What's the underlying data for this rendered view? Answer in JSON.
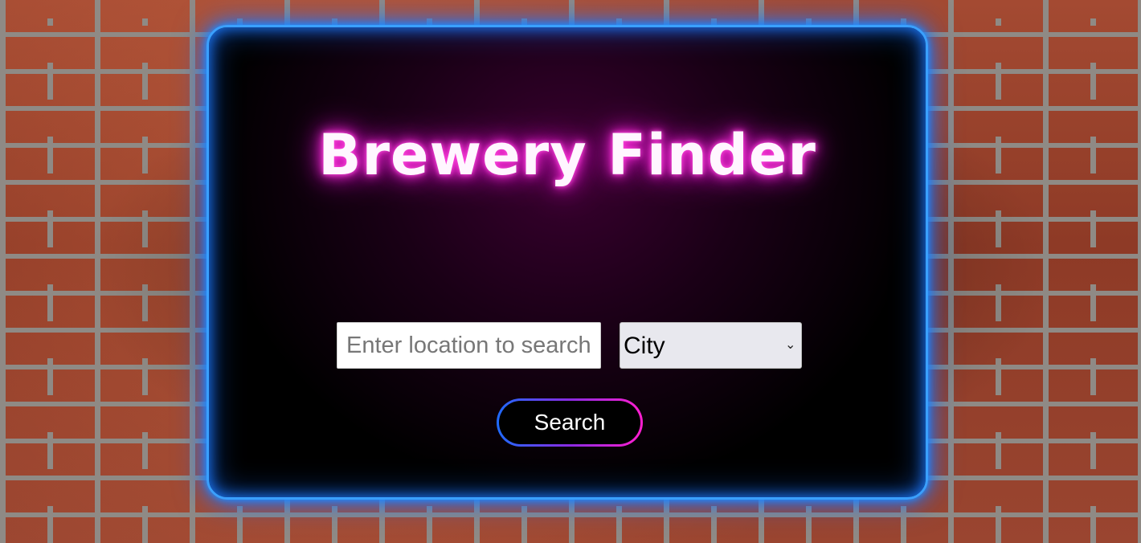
{
  "app": {
    "title": "Brewery Finder"
  },
  "search": {
    "location_placeholder": "Enter location to search",
    "location_value": "",
    "type_selected": "City",
    "type_options": [
      "City"
    ],
    "button_label": "Search"
  },
  "icons": {
    "select_chevron": "chevron-down-icon"
  },
  "colors": {
    "panel_border": "#3aa0ff",
    "title_glow": "#ff2bd6",
    "button_gradient_start": "#1e6bff",
    "button_gradient_end": "#ff1ed0"
  }
}
